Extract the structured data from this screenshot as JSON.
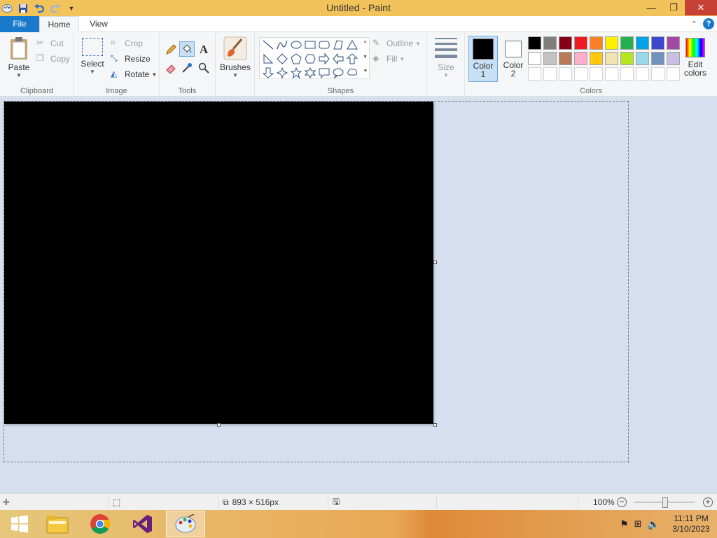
{
  "window": {
    "title": "Untitled - Paint"
  },
  "tabs": [
    {
      "label": "File"
    },
    {
      "label": "Home"
    },
    {
      "label": "View"
    }
  ],
  "clipboard": {
    "paste": "Paste",
    "cut": "Cut",
    "copy": "Copy",
    "group": "Clipboard"
  },
  "image": {
    "select": "Select",
    "crop": "Crop",
    "resize": "Resize",
    "rotate": "Rotate",
    "group": "Image"
  },
  "tools": {
    "group": "Tools",
    "selected": "fill-bucket"
  },
  "brushes": {
    "label": "Brushes"
  },
  "shapes": {
    "group": "Shapes",
    "outline": "Outline",
    "fill": "Fill"
  },
  "size": {
    "label": "Size"
  },
  "colors": {
    "group": "Colors",
    "color1_label": "Color",
    "color1_num": "1",
    "color2_label": "Color",
    "color2_num": "2",
    "color1": "#000000",
    "color2": "#ffffff",
    "edit_label1": "Edit",
    "edit_label2": "colors",
    "palette_row1": [
      "#000000",
      "#7f7f7f",
      "#880015",
      "#ed1c24",
      "#ff7f27",
      "#fff200",
      "#22b14c",
      "#00a2e8",
      "#3f48cc",
      "#a349a4"
    ],
    "palette_row2": [
      "#ffffff",
      "#c3c3c3",
      "#b97a57",
      "#ffaec9",
      "#ffc90e",
      "#efe4b0",
      "#b5e61d",
      "#99d9ea",
      "#7092be",
      "#c8bfe7"
    ]
  },
  "canvas": {
    "fill": "#000000"
  },
  "status": {
    "dimensions": "893 × 516px",
    "zoom": "100%"
  },
  "taskbar": {
    "time": "11:11 PM",
    "date": "3/10/2023"
  }
}
